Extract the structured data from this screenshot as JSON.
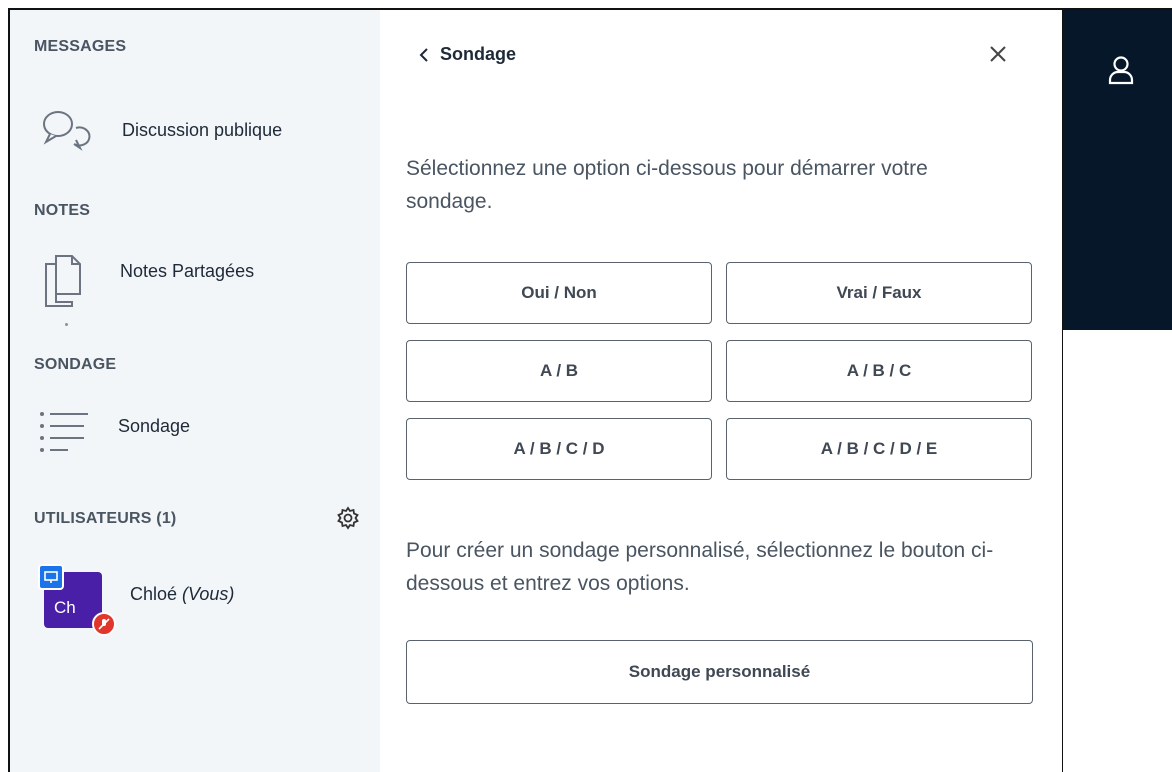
{
  "sidebar": {
    "messages": {
      "title": "MESSAGES",
      "public_chat": "Discussion publique"
    },
    "notes": {
      "title": "NOTES",
      "shared_notes": "Notes Partagées"
    },
    "poll": {
      "title": "SONDAGE",
      "item": "Sondage"
    },
    "users": {
      "title": "UTILISATEURS (1)",
      "list": [
        {
          "initials": "Ch",
          "name": "Chloé",
          "suffix": "(Vous)"
        }
      ]
    }
  },
  "panel": {
    "title": "Sondage",
    "intro": "Sélectionnez une option ci-dessous pour démarrer votre sondage.",
    "options": [
      "Oui / Non",
      "Vrai / Faux",
      "A / B",
      "A / B / C",
      "A / B / C / D",
      "A / B / C / D / E"
    ],
    "custom_intro": "Pour créer un sondage personnalisé, sélectionnez le bouton ci-dessous et entrez vos options.",
    "custom_button": "Sondage personnalisé"
  },
  "colors": {
    "sidebar_bg": "#f3f6f9",
    "topbar_bg": "#06172a",
    "avatar_bg": "#4a1fa8",
    "presenter_badge": "#1a73e8",
    "muted_badge": "#e0362b"
  },
  "icons": {
    "chat": "chat-bubbles-icon",
    "notes": "documents-icon",
    "poll": "list-icon",
    "settings": "gear-icon",
    "back": "chevron-left-icon",
    "close": "close-icon",
    "user": "user-icon",
    "presenter": "presenter-icon",
    "muted": "microphone-off-icon"
  }
}
